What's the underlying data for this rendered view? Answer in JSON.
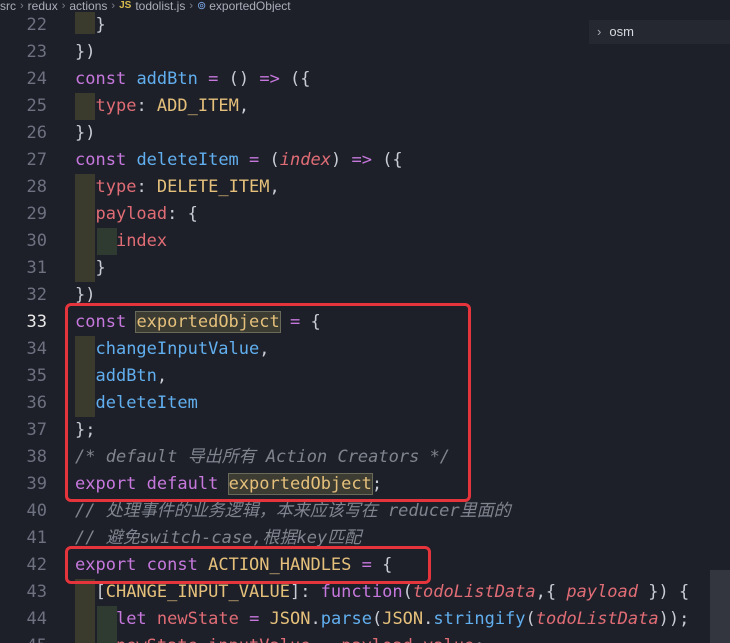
{
  "breadcrumb": {
    "items": [
      "src",
      "redux",
      "actions",
      "todolist.js",
      "exportedObject"
    ],
    "file_badge": "JS"
  },
  "outline": {
    "label": "osm"
  },
  "colors": {
    "background": "#1e2029",
    "highlight_box": "#e5343c",
    "keyword": "#c678dd",
    "function": "#61afef",
    "constant": "#e5c07b"
  },
  "lines": [
    {
      "n": "22",
      "text": "  }"
    },
    {
      "n": "23",
      "text": "})"
    },
    {
      "n": "24",
      "text": "const addBtn = () => ({"
    },
    {
      "n": "25",
      "text": "  type: ADD_ITEM,"
    },
    {
      "n": "26",
      "text": "})"
    },
    {
      "n": "27",
      "text": "const deleteItem = (index) => ({"
    },
    {
      "n": "28",
      "text": "  type: DELETE_ITEM,"
    },
    {
      "n": "29",
      "text": "  payload: {"
    },
    {
      "n": "30",
      "text": "    index"
    },
    {
      "n": "31",
      "text": "  }"
    },
    {
      "n": "32",
      "text": "})"
    },
    {
      "n": "33",
      "text": "const exportedObject = {"
    },
    {
      "n": "34",
      "text": "  changeInputValue,"
    },
    {
      "n": "35",
      "text": "  addBtn,"
    },
    {
      "n": "36",
      "text": "  deleteItem"
    },
    {
      "n": "37",
      "text": "};"
    },
    {
      "n": "38",
      "text": "/* default 导出所有 Action Creators */"
    },
    {
      "n": "39",
      "text": "export default exportedObject;"
    },
    {
      "n": "40",
      "text": "// 处理事件的业务逻辑，本来应该写在 reducer里面的"
    },
    {
      "n": "41",
      "text": "// 避免switch-case,根据key匹配"
    },
    {
      "n": "42",
      "text": "export const ACTION_HANDLES = {"
    },
    {
      "n": "43",
      "text": "  [CHANGE_INPUT_VALUE]: function(todoListData,{ payload }) {"
    },
    {
      "n": "44",
      "text": "    let newState = JSON.parse(JSON.stringify(todoListData));"
    },
    {
      "n": "45",
      "text": "    newState.inputValue = payload.value;"
    }
  ]
}
